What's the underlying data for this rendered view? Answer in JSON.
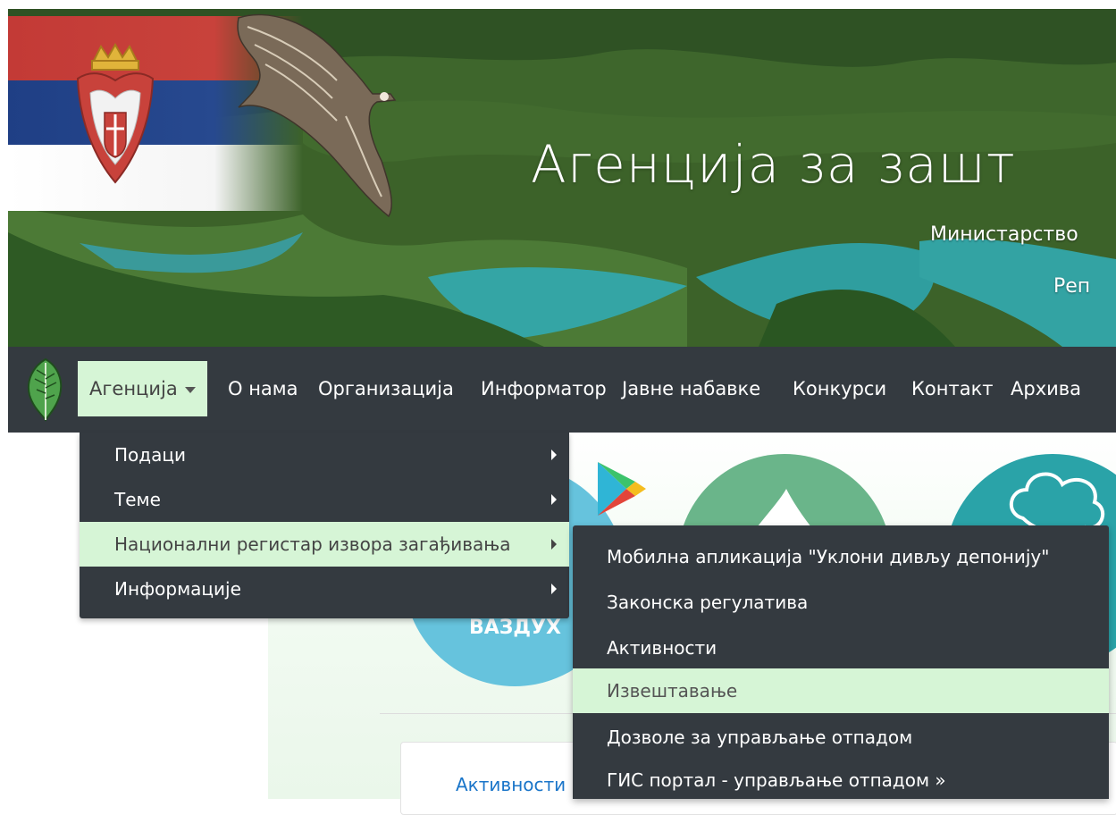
{
  "banner": {
    "title": "Агенција за зашт",
    "subtitle_ministry": "Министарство",
    "subtitle_republic": "Реп"
  },
  "navbar": {
    "items": [
      {
        "label": "Агенција",
        "active": true
      },
      {
        "label": "О нама"
      },
      {
        "label": "Организација"
      },
      {
        "label": "Информатор"
      },
      {
        "label": "Јавне набавке"
      },
      {
        "label": "Конкурси"
      },
      {
        "label": "Контакт"
      },
      {
        "label": "Архива"
      }
    ]
  },
  "dropdown": {
    "items": [
      {
        "label": "Подаци"
      },
      {
        "label": "Теме"
      },
      {
        "label": "Национални регистар извора загађивања",
        "highlighted": true
      },
      {
        "label": "Информације"
      }
    ]
  },
  "submenu": {
    "items": [
      {
        "label": "Мобилна апликација \"Уклони дивљу депонију\""
      },
      {
        "label": "Законска регулатива"
      },
      {
        "label": "Активности"
      },
      {
        "label": "Извештавање",
        "highlighted": true
      },
      {
        "label": "Дозволе за управљање отпадом"
      },
      {
        "label": "ГИС портал - управљање отпадом »"
      }
    ]
  },
  "content": {
    "air_label": "ВАЗДУХ",
    "card_link": "Активности"
  },
  "colors": {
    "navbar_bg": "#343a40",
    "highlight_bg": "#d6f5d6",
    "link": "#1a75c9"
  }
}
